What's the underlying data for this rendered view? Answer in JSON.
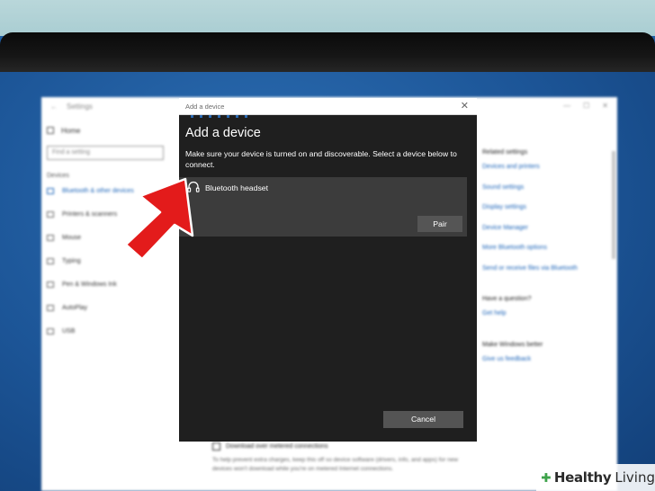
{
  "settings_window": {
    "title": "Settings",
    "nav": {
      "home": "Home",
      "search_placeholder": "Find a setting",
      "group": "Devices",
      "items": [
        {
          "label": "Bluetooth & other devices",
          "active": true
        },
        {
          "label": "Printers & scanners"
        },
        {
          "label": "Mouse"
        },
        {
          "label": "Typing"
        },
        {
          "label": "Pen & Windows Ink"
        },
        {
          "label": "AutoPlay"
        },
        {
          "label": "USB"
        }
      ]
    },
    "related": {
      "heading": "Related settings",
      "links": [
        "Devices and printers",
        "Sound settings",
        "Display settings",
        "Device Manager",
        "More Bluetooth options",
        "Send or receive files via Bluetooth"
      ],
      "question_heading": "Have a question?",
      "question_link": "Get help",
      "better_heading": "Make Windows better",
      "better_link": "Give us feedback"
    },
    "metered": {
      "checkbox_label": "Download over metered connections",
      "help_text": "To help prevent extra charges, keep this off so device software (drivers, info, and apps) for new devices won't download while you're on metered Internet connections."
    }
  },
  "dialog": {
    "titlebar": "Add a device",
    "close_glyph": "✕",
    "heading": "Add a device",
    "description": "Make sure your device is turned on and discoverable. Select a device below to connect.",
    "device": {
      "name": "Bluetooth headset",
      "icon": "headphones-icon"
    },
    "pair_label": "Pair",
    "cancel_label": "Cancel"
  },
  "watermark": {
    "bold": "Healthy",
    "regular": "Living"
  },
  "colors": {
    "dialog_bg": "#1f1f1f",
    "device_row": "#3c3c3c",
    "button": "#555555",
    "arrow": "#e31b1b",
    "accent": "#2b7bd6",
    "watermark_green": "#3da24a"
  }
}
